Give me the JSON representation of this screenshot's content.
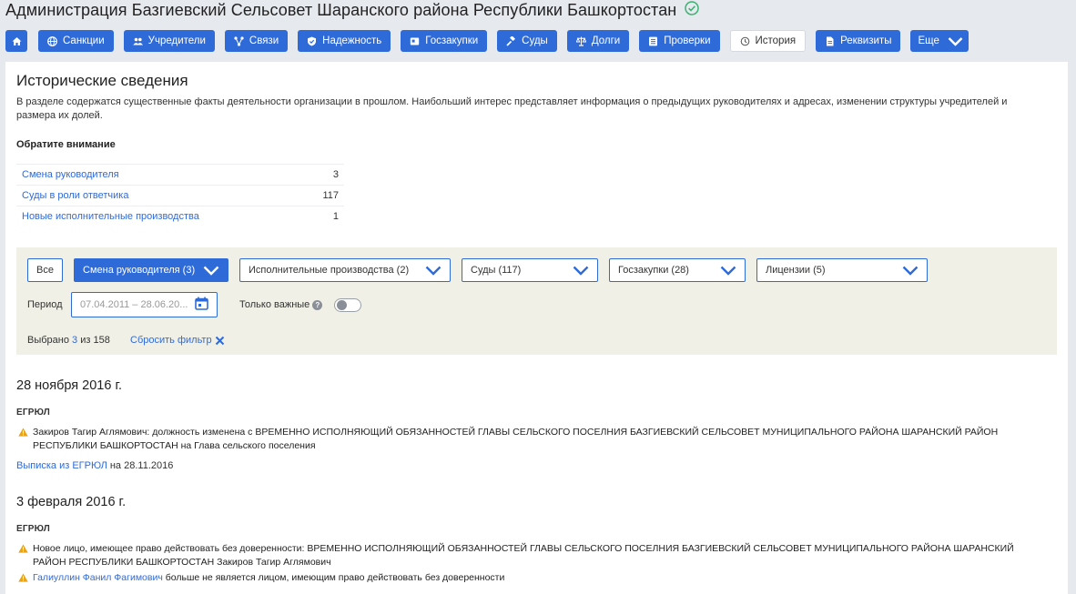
{
  "page_title": "Администрация Базгиевский Сельсовет Шаранского района Республики Башкортостан",
  "nav": {
    "items": [
      {
        "label": "Санкции",
        "icon": "globe-icon"
      },
      {
        "label": "Учредители",
        "icon": "users-icon"
      },
      {
        "label": "Связи",
        "icon": "network-icon"
      },
      {
        "label": "Надежность",
        "icon": "shield-icon"
      },
      {
        "label": "Госзакупки",
        "icon": "contract-icon"
      },
      {
        "label": "Суды",
        "icon": "gavel-icon"
      },
      {
        "label": "Долги",
        "icon": "scales-icon"
      },
      {
        "label": "Проверки",
        "icon": "checklist-icon"
      },
      {
        "label": "История",
        "icon": "clock-icon"
      },
      {
        "label": "Реквизиты",
        "icon": "document-icon"
      },
      {
        "label": "Еще",
        "icon": "chevron-down-icon"
      }
    ]
  },
  "section": {
    "title": "Исторические сведения",
    "description": "В разделе содержатся существенные факты деятельности организации в прошлом. Наибольший интерес представляет информация о предыдущих руководителях и адресах, изменении структуры учредителей и размера их долей.",
    "attention_title": "Обратите внимание"
  },
  "summary": [
    {
      "label": "Смена руководителя",
      "count": "3"
    },
    {
      "label": "Суды в роли ответчика",
      "count": "117"
    },
    {
      "label": "Новые исполнительные производства",
      "count": "1"
    }
  ],
  "filter": {
    "all_label": "Все",
    "dropdowns": [
      "Смена руководителя (3)",
      "Исполнительные производства (2)",
      "Суды (117)",
      "Госзакупки (28)",
      "Лицензии (5)"
    ],
    "period_label": "Период",
    "period_placeholder": "07.04.2011 – 28.06.20...",
    "only_important_label": "Только важные",
    "selected_prefix": "Выбрано",
    "selected_count": "3",
    "selected_suffix": "из 158",
    "reset_label": "Сбросить фильтр"
  },
  "events": [
    {
      "date": "28 ноября 2016 г.",
      "source": "ЕГРЮЛ",
      "items": [
        {
          "text": "Закиров Тагир Аглямович: должность изменена с ВРЕМЕННО ИСПОЛНЯЮЩИЙ ОБЯЗАННОСТЕЙ ГЛАВЫ СЕЛЬСКОГО ПОСЕЛНИЯ БАЗГИЕВСКИЙ СЕЛЬСОВЕТ МУНИЦИПАЛЬНОГО РАЙОНА ШАРАНСКИЙ РАЙОН РЕСПУБЛИКИ БАШКОРТОСТАН на Глава сельского поселения"
        }
      ],
      "extract_link": "Выписка из ЕГРЮЛ",
      "extract_suffix": "на 28.11.2016"
    },
    {
      "date": "3 февраля 2016 г.",
      "source": "ЕГРЮЛ",
      "items": [
        {
          "text": "Новое лицо, имеющее право действовать без доверенности: ВРЕМЕННО ИСПОЛНЯЮЩИЙ ОБЯЗАННОСТЕЙ ГЛАВЫ СЕЛЬСКОГО ПОСЕЛНИЯ БАЗГИЕВСКИЙ СЕЛЬСОВЕТ МУНИЦИПАЛЬНОГО РАЙОНА ШАРАНСКИЙ РАЙОН РЕСПУБЛИКИ БАШКОРТОСТАН Закиров Тагир Аглямович"
        },
        {
          "link": "Галиуллин Фанил Фагимович",
          "text": "больше не является лицом, имеющим право действовать без доверенности"
        }
      ]
    }
  ],
  "colors": {
    "accent": "#2f6bd8",
    "warning": "#e8a317",
    "verified": "#3cb371",
    "filter_bg": "#f1f0e6"
  }
}
